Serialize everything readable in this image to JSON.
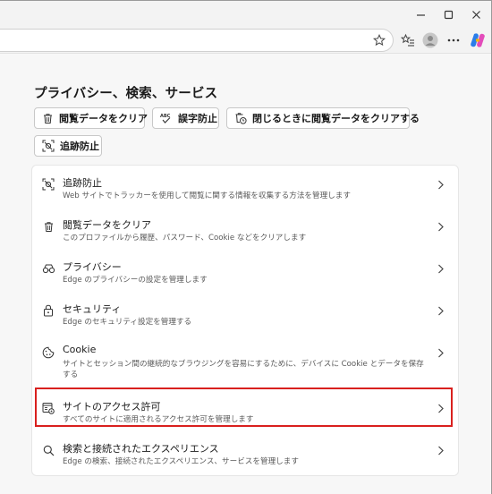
{
  "window": {
    "minimize_icon": "minimize-icon",
    "maximize_icon": "maximize-icon",
    "close_icon": "close-icon"
  },
  "toolbar": {
    "icons": [
      "favorite-star-icon",
      "favorites-list-icon",
      "profile-avatar-icon",
      "more-menu-icon",
      "copilot-icon"
    ]
  },
  "section": {
    "title": "プライバシー、検索、サービス"
  },
  "quick_actions": [
    {
      "label": "閲覧データをクリア",
      "icon": "trash-icon"
    },
    {
      "label": "誤字防止",
      "icon": "spellcheck-icon"
    },
    {
      "label": "閉じるときに閲覧データをクリアする",
      "icon": "trash-clock-icon"
    },
    {
      "label": "追跡防止",
      "icon": "tracking-prevention-icon"
    }
  ],
  "settings": [
    {
      "title": "追跡防止",
      "desc": "Web サイトでトラッカーを使用して閲覧に関する情報を収集する方法を管理します",
      "icon": "tracking-prevention-icon"
    },
    {
      "title": "閲覧データをクリア",
      "desc": "このプロファイルから履歴、パスワード、Cookie などをクリアします",
      "icon": "trash-icon"
    },
    {
      "title": "プライバシー",
      "desc": "Edge のプライバシーの設定を管理します",
      "icon": "glasses-icon"
    },
    {
      "title": "セキュリティ",
      "desc": "Edge のセキュリティ設定を管理する",
      "icon": "lock-icon"
    },
    {
      "title": "Cookie",
      "desc": "サイトとセッション間の継続的なブラウジングを容易にするために、デバイスに Cookie とデータを保存する",
      "icon": "cookie-icon"
    },
    {
      "title": "サイトのアクセス許可",
      "desc": "すべてのサイトに適用されるアクセス許可を管理します",
      "icon": "site-permissions-icon"
    },
    {
      "title": "検索と接続されたエクスペリエンス",
      "desc": "Edge の検索、接続されたエクスペリエンス、サービスを管理します",
      "icon": "search-icon"
    }
  ],
  "colors": {
    "highlight": "#d9201e",
    "accent": "#0f6cbd"
  }
}
